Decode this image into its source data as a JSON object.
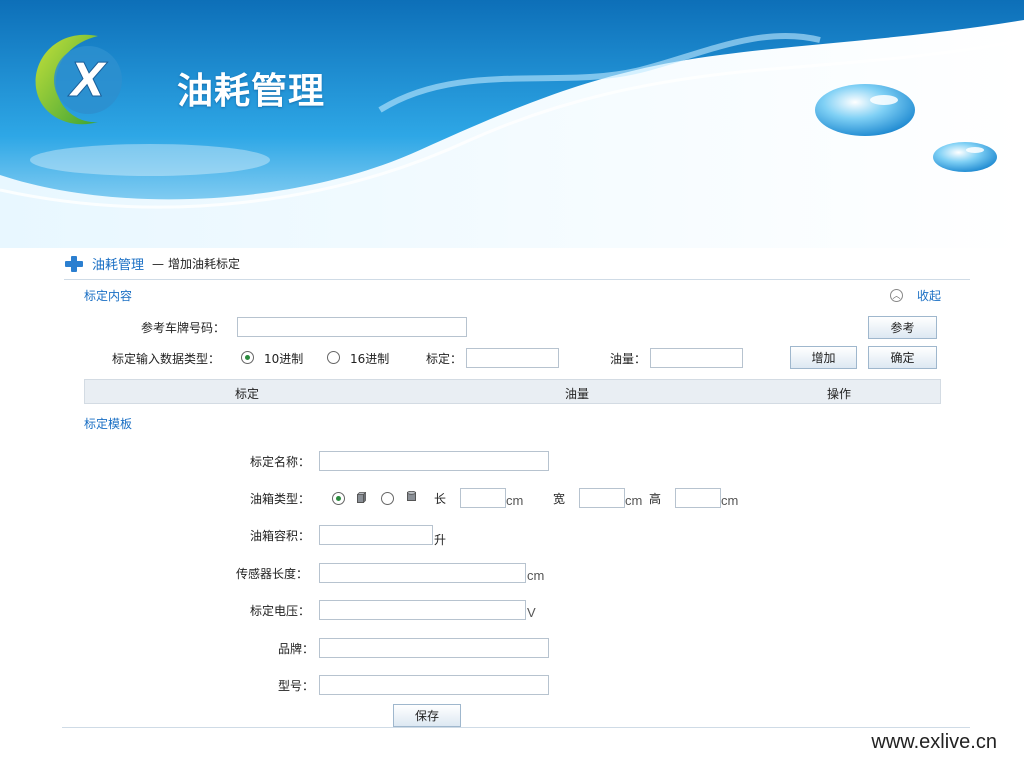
{
  "header": {
    "title": "油耗管理"
  },
  "breadcrumb": {
    "root": "油耗管理",
    "separator": "—",
    "current": "增加油耗标定"
  },
  "section_content": {
    "title": "标定内容",
    "collapse_label": "收起",
    "plate_label": "参考车牌号码：",
    "plate_value": "",
    "reference_button": "参考",
    "input_type_label": "标定输入数据类型：",
    "radio_decimal": "10进制",
    "radio_hex": "16进制",
    "radio_selected": "10进制",
    "calib_label": "标定：",
    "calib_value": "",
    "oil_label": "油量：",
    "oil_value": "",
    "add_button": "增加",
    "confirm_button": "确定",
    "table": {
      "columns": [
        "标定",
        "油量",
        "操作"
      ],
      "rows": []
    }
  },
  "section_template": {
    "title": "标定模板",
    "name_label": "标定名称：",
    "tank_type_label": "油箱类型：",
    "tank_shapes": [
      "box-tank-icon",
      "cylinder-tank-icon"
    ],
    "tank_selected": "box",
    "length_label": "长",
    "width_label": "宽",
    "height_label": "高",
    "cm": "cm",
    "volume_label": "油箱容积：",
    "volume_unit": "升",
    "sensor_label": "传感器长度：",
    "sensor_unit": "cm",
    "voltage_label": "标定电压：",
    "voltage_unit": "V",
    "brand_label": "品牌：",
    "model_label": "型号：",
    "save_button": "保存"
  },
  "footer": {
    "url": "www.exlive.cn"
  },
  "colors": {
    "accent": "#1a6fc4",
    "banner": "#1e8fd6",
    "selected_radio": "#2b8a3e"
  }
}
